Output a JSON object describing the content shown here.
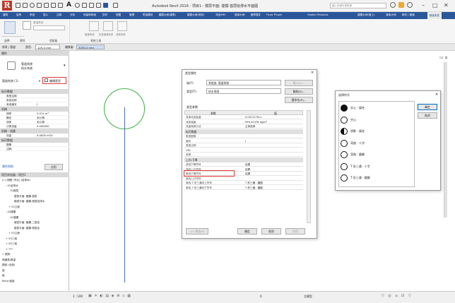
{
  "window": {
    "title": "Autodesk Revit 2016 -  项目1 - 楼层平面: 建模-首层给排水平面图",
    "search_placeholder": "键入关键字或短语"
  },
  "ribbon": {
    "tabs": [
      "建筑",
      "结构",
      "系统",
      "插入",
      "注释",
      "分析",
      "体量和场地",
      "协作",
      "视图",
      "管理",
      "附加模块",
      "建模大师(建筑)",
      "建模大师(机电)",
      "鸿业BIM",
      "族库大师",
      "速博插件",
      "Fuzor Plugin",
      "Glodon Products",
      "建模大师(施工)",
      "族库大师",
      "修改 | 管道",
      "管道类型"
    ],
    "active_tab": "管道类型",
    "panel_labels": [
      "选择",
      "属性",
      "剪贴板",
      "系统工具"
    ],
    "system_tool_labels": [
      "管道系统",
      "检查管道系统",
      "选择系统"
    ],
    "type_label": "管道类型"
  },
  "options_bar": {
    "label": "修改 | 管道",
    "diameter_label": "直径:",
    "diameter_value": "125.0 mm",
    "offset_label": "偏移量:",
    "offset_value": "3250.0 mm"
  },
  "properties": {
    "header": "属性",
    "type_line1": "管道系统",
    "type_line2": "给水系统",
    "selector": "管道系统 (1)",
    "edit_type": "编辑类型",
    "sections": [
      {
        "title": "标识数据",
        "rows": [
          [
            "类型注释",
            ""
          ],
          [
            "系统名称",
            ""
          ],
          [
            "系统缩写",
            "J"
          ]
        ]
      },
      {
        "title": "机械",
        "rows": [
          [
            "体积",
            "0.011 m³"
          ],
          [
            "静压",
            "未计算"
          ],
          [
            "流体",
            "未计算"
          ],
          [
            "计算流量",
            "0.000000"
          ]
        ]
      },
      {
        "title": "机械 - 流量",
        "rows": [
          [
            "流量",
            "0.0000 m³/h"
          ]
        ]
      },
      {
        "title": "标识数据",
        "rows": [
          [
            "图像",
            ""
          ],
          [
            "注释",
            ""
          ]
        ]
      }
    ],
    "help_link": "属性帮助",
    "apply": "应用"
  },
  "browser": {
    "title": "项目浏览器 - 项目1",
    "items": [
      "[+] 视图 (专业)-(给排水)",
      "- 01给排水",
      "- 01楼层",
      "楼层平面: 建模-首层",
      "楼层平面: 建模-首层给排水",
      "+ 02立面",
      "- 02建模",
      "- 01建模",
      "楼层平面: 建模-二层给",
      "楼层平面: 建模-首层给",
      "+ 02立面",
      "+ 03三维",
      "+ 04三维",
      "+ ???",
      "+ 图例",
      "明细表/数量",
      "图纸 (全部)",
      "族",
      "组",
      "Revit 链接"
    ]
  },
  "type_properties": {
    "title": "类型属性",
    "family_label": "族(F):",
    "family_value": "系统族: 管道系统",
    "type_label": "类型(T):",
    "type_value": "给水系统",
    "load": "载入(L)...",
    "duplicate": "复制(D)...",
    "rename": "重命名(R)...",
    "params_label": "类型参数",
    "col_param": "参数",
    "col_value": "值",
    "rows": [
      {
        "g": false,
        "k": "流体动态粘度",
        "v": "0.00112 Pa-s"
      },
      {
        "g": false,
        "k": "流体温度",
        "v": "999.01378 kg/m³"
      },
      {
        "g": false,
        "k": "流量转换方法",
        "v": "主体选择"
      },
      {
        "g": true,
        "k": "标识数据",
        "v": ""
      },
      {
        "g": false,
        "k": "类型图像",
        "v": ""
      },
      {
        "g": false,
        "k": "缩写",
        "v": "J"
      },
      {
        "g": false,
        "k": "类型注释",
        "v": ""
      },
      {
        "g": false,
        "k": "URL",
        "v": ""
      },
      {
        "g": false,
        "k": "说明",
        "v": ""
      },
      {
        "g": true,
        "k": "上升/下降",
        "v": ""
      },
      {
        "g": false,
        "k": "双线下降符号",
        "v": "结果"
      },
      {
        "g": false,
        "k": "双线上升符号",
        "v": "结果"
      },
      {
        "g": false,
        "k": "单线下降符号",
        "v": "结果"
      },
      {
        "g": false,
        "k": "单线上升符号",
        "v": ""
      },
      {
        "g": false,
        "k": "单线 T 形三通向上符号",
        "v": "T 形三通 - 圆圈"
      },
      {
        "g": false,
        "k": "单线 T 形三通向下符号",
        "v": "T 形三通 - 圆圈"
      }
    ],
    "preview": "<< 预览(P)",
    "ok": "确定",
    "cancel": "取消",
    "apply": "应用"
  },
  "symbol_dialog": {
    "title": "选择符号",
    "ok": "确定",
    "cancel": "取消",
    "items": [
      "实心 - 填充",
      "空心",
      "阴影 - 填充",
      "弯曲 - 十字",
      "弯曲 - 圆圈",
      "T 形三通 - 十字",
      "T 形三通 - 圆圈"
    ]
  },
  "statusbar": {
    "scale": "1 : 100",
    "model": "主模型",
    "filter": "0"
  },
  "colors": {
    "ribbon_blue": "#2b579a",
    "highlight_red": "#e53935",
    "pipe_blue": "#4a6fb5",
    "circle_green": "#3cb043"
  }
}
